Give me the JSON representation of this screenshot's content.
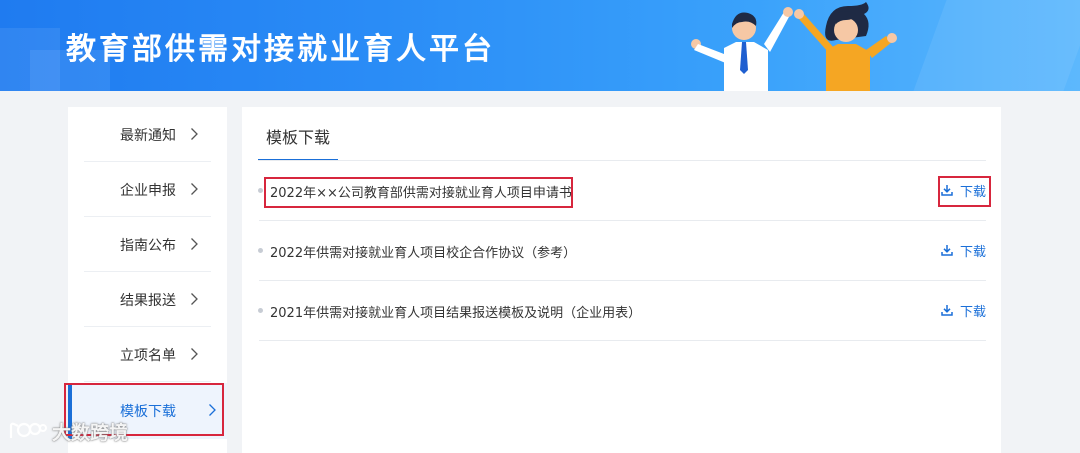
{
  "banner": {
    "title": "教育部供需对接就业育人平台"
  },
  "sidebar": {
    "items": [
      {
        "label": "最新通知"
      },
      {
        "label": "企业申报"
      },
      {
        "label": "指南公布"
      },
      {
        "label": "结果报送"
      },
      {
        "label": "立项名单"
      },
      {
        "label": "模板下载",
        "active": true
      }
    ]
  },
  "main": {
    "tab_label": "模板下载",
    "rows": [
      {
        "title": "2022年××公司教育部供需对接就业育人项目申请书",
        "download_label": "下载"
      },
      {
        "title": "2022年供需对接就业育人项目校企合作协议（参考）",
        "download_label": "下载"
      },
      {
        "title": "2021年供需对接就业育人项目结果报送模板及说明（企业用表）",
        "download_label": "下载"
      }
    ]
  },
  "watermark": {
    "text": "大数跨境"
  },
  "colors": {
    "accent": "#1a6fd8",
    "highlight": "#d7263d",
    "banner": "#2a8cf6"
  }
}
